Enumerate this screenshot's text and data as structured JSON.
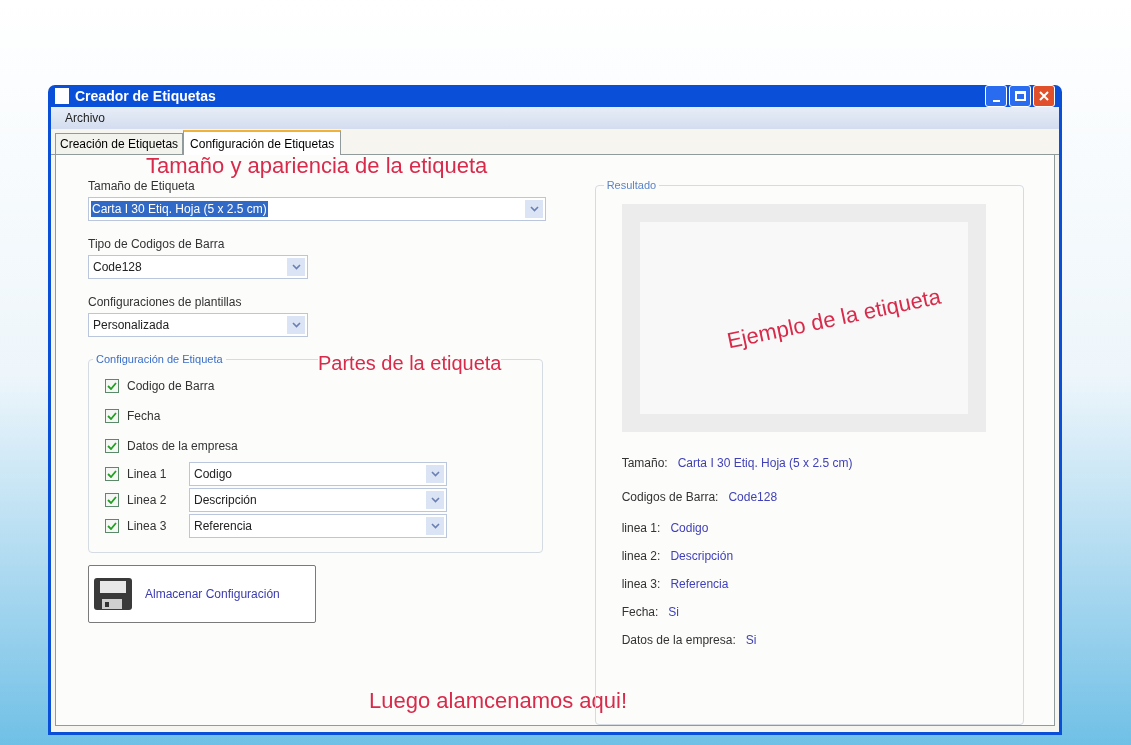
{
  "window": {
    "title": "Creador de Etiquetas"
  },
  "menu": [
    {
      "label": "Archivo"
    }
  ],
  "tabs": [
    {
      "label": "Creación de Etiquetas",
      "selected": false
    },
    {
      "label": "Configuración de Etiquetas",
      "selected": true
    }
  ],
  "fields": [
    {
      "label": "Tamaño de Etiqueta",
      "value": "Carta I 30 Etiq. Hoja (5 x 2.5 cm)",
      "highlighted": true,
      "wide": true
    },
    {
      "label": "Tipo de Codigos de Barra",
      "value": "Code128",
      "highlighted": false,
      "wide": false
    },
    {
      "label": "Configuraciones de plantillas",
      "value": "Personalizada",
      "highlighted": false,
      "wide": false
    }
  ],
  "label_config": {
    "title": "Configuración de Etiqueta",
    "options": [
      {
        "kind": "check",
        "label": "Codigo de Barra",
        "checked": true
      },
      {
        "kind": "check",
        "label": "Fecha",
        "checked": true
      },
      {
        "kind": "check",
        "label": "Datos de la empresa",
        "checked": true
      },
      {
        "kind": "line",
        "label": "Linea 1",
        "checked": true,
        "value": "Codigo"
      },
      {
        "kind": "line",
        "label": "Linea 2",
        "checked": true,
        "value": "Descripción"
      },
      {
        "kind": "line",
        "label": "Linea 3",
        "checked": true,
        "value": "Referencia"
      }
    ]
  },
  "save_button": {
    "label": "Almacenar Configuración"
  },
  "result": {
    "title": "Resultado",
    "summary": [
      {
        "label": "Tamaño:",
        "value": "Carta I 30 Etiq. Hoja (5 x 2.5 cm)"
      },
      {
        "label": "Codigos de Barra:",
        "value": "Code128"
      },
      {
        "label": "linea 1:",
        "value": "Codigo"
      },
      {
        "label": "linea 2:",
        "value": "Descripción"
      },
      {
        "label": "linea 3:",
        "value": "Referencia"
      },
      {
        "label": "Fecha:",
        "value": "Si"
      },
      {
        "label": "Datos de la empresa:",
        "value": "Si"
      }
    ]
  },
  "annotations": {
    "size": "Tamaño y apariencia de la etiqueta",
    "parts": "Partes de la etiqueta",
    "example": "Ejemplo de la etiqueta",
    "save": "Luego alamcenamos aqui!"
  }
}
